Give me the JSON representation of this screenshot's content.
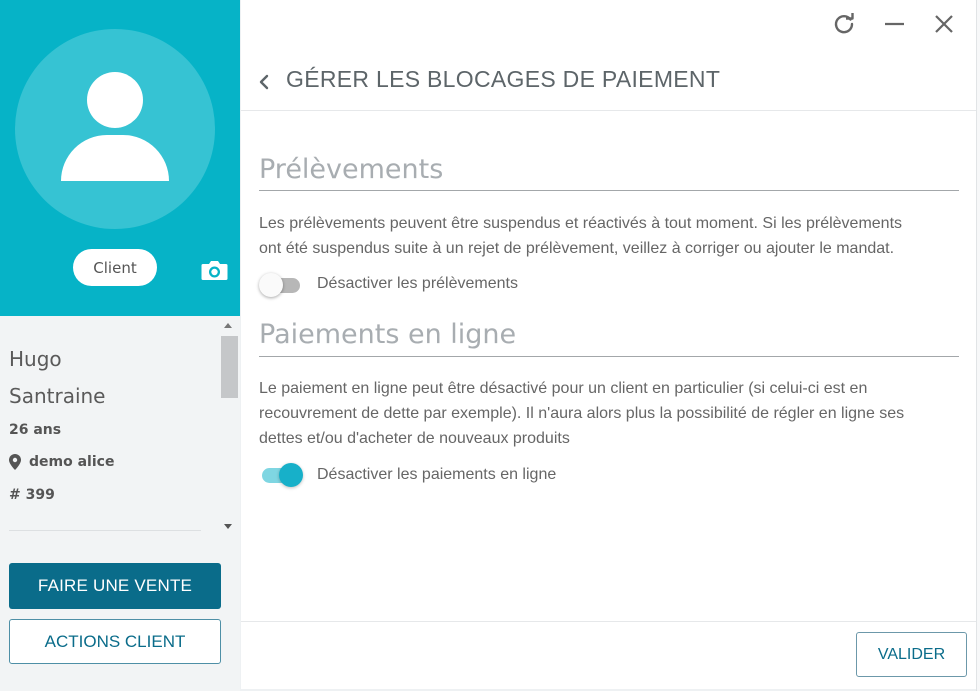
{
  "colors": {
    "accent": "#06b3c7",
    "primary": "#0a6c8a",
    "toggle_on": "#17b0c9"
  },
  "profile": {
    "badge": "Client",
    "first_name": "Hugo",
    "last_name": "Santraine",
    "age": "26 ans",
    "location": "demo alice",
    "number": "# 399"
  },
  "left_actions": {
    "sale": "FAIRE UNE VENTE",
    "client_actions": "ACTIONS CLIENT"
  },
  "window_controls": [
    "refresh-icon",
    "minimize-icon",
    "close-icon"
  ],
  "dialog": {
    "title": "GÉRER LES BLOCAGES DE PAIEMENT",
    "sections": [
      {
        "title": "Prélèvements",
        "lines": [
          "Les prélèvements peuvent être suspendus et réactivés à tout moment. Si les prélèvements",
          "ont été suspendus suite à un rejet de prélèvement, veillez à corriger ou ajouter le mandat."
        ],
        "toggle_label": "Désactiver les prélèvements",
        "toggle_on": false
      },
      {
        "title": "Paiements en ligne",
        "lines": [
          "Le paiement en ligne peut être désactivé pour un client en particulier (si celui-ci est en",
          "recouvrement de dette par exemple). Il n'aura alors plus la possibilité de régler en ligne ses",
          "dettes et/ou d'acheter de nouveaux produits"
        ],
        "toggle_label": "Désactiver les paiements en ligne",
        "toggle_on": true
      }
    ],
    "validate": "VALIDER"
  }
}
